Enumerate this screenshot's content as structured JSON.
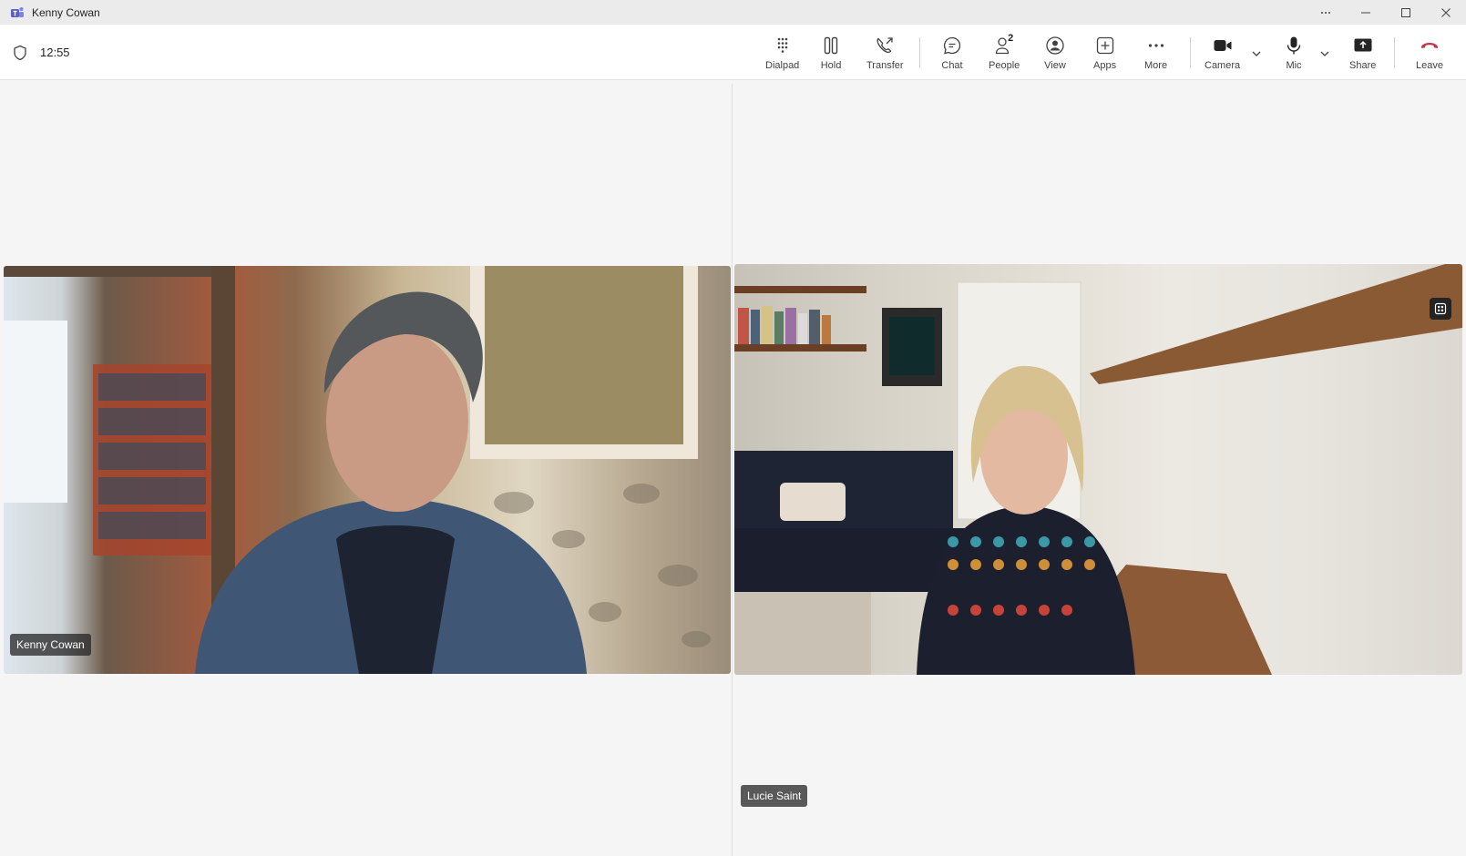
{
  "window": {
    "title": "Kenny Cowan"
  },
  "call": {
    "elapsed": "12:55"
  },
  "toolbar": {
    "dialpad": "Dialpad",
    "hold": "Hold",
    "transfer": "Transfer",
    "chat": "Chat",
    "people": "People",
    "people_count": "2",
    "view": "View",
    "apps": "Apps",
    "more": "More",
    "camera": "Camera",
    "mic": "Mic",
    "share": "Share",
    "leave": "Leave"
  },
  "participants": [
    {
      "name": "Kenny Cowan"
    },
    {
      "name": "Lucie Saint"
    }
  ],
  "colors": {
    "leave": "#c4314b",
    "brand": "#5b5fc7"
  }
}
